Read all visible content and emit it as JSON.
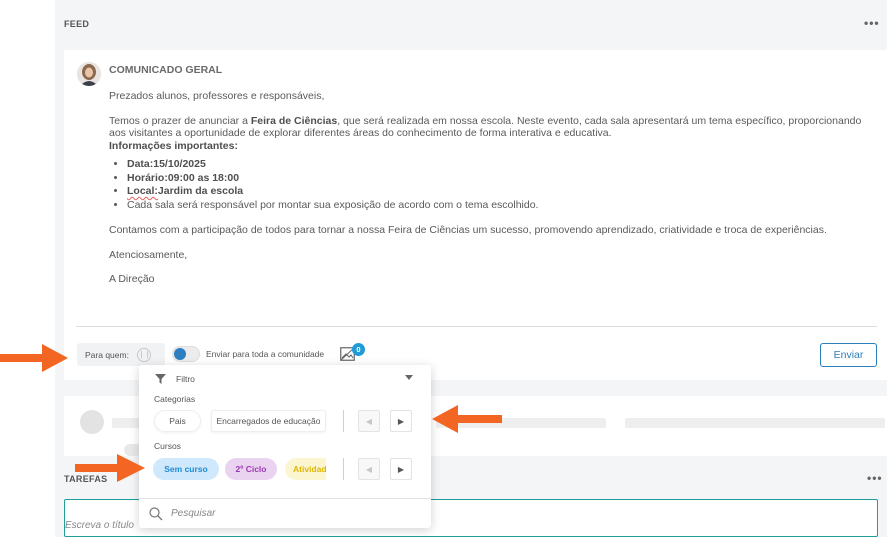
{
  "feed": {
    "title": "FEED",
    "more": "•••"
  },
  "post": {
    "title": "COMUNICADO GERAL",
    "greeting": "Prezados alunos, professores e responsáveis,",
    "intro_prefix": "Temos o prazer de anunciar a ",
    "intro_bold": "Feira de Ciências",
    "intro_suffix": ", que será realizada em nossa escola. Neste evento, cada sala apresentará um tema específico, proporcionando aos visitantes a oportunidade de explorar diferentes áreas do conhecimento de forma interativa e educativa.",
    "info_heading": "Informações importantes:",
    "items": [
      "Data:15/10/2025",
      "Horário:09:00 as 18:00",
      "Jardim da escola",
      "Cada sala será responsável por montar sua exposição de acordo com o tema escolhido."
    ],
    "local_label": "Local:",
    "closing": "Contamos com a participação de todos para tornar a nossa Feira de Ciências um sucesso, promovendo aprendizado, criatividade e troca de experiências.",
    "regards": "Atenciosamente,",
    "signature": "A Direção"
  },
  "compose": {
    "para_quem": "Para quem:",
    "toggle_label": "Enviar para toda a comunidade",
    "attachment_count": "0",
    "send": "Enviar"
  },
  "filter": {
    "label": "Filtro",
    "categories_label": "Categorias",
    "categories": [
      "Pais",
      "Encarregados de educação"
    ],
    "courses_label": "Cursos",
    "courses": [
      "Sem curso",
      "2º Ciclo",
      "Atividades"
    ],
    "nav_prev": "◀",
    "nav_next": "▶",
    "search_placeholder": "Pesquisar"
  },
  "tasks": {
    "title": "TAREFAS",
    "more": "•••",
    "input_placeholder": "Escreva o título"
  },
  "colors": {
    "primary": "#2a7fb8",
    "badge": "#1f9bd8",
    "arrow": "#f26522",
    "chip_blue": "#1d8bd6",
    "chip_purple": "#9b3bb0",
    "chip_yellow": "#e1b400"
  }
}
